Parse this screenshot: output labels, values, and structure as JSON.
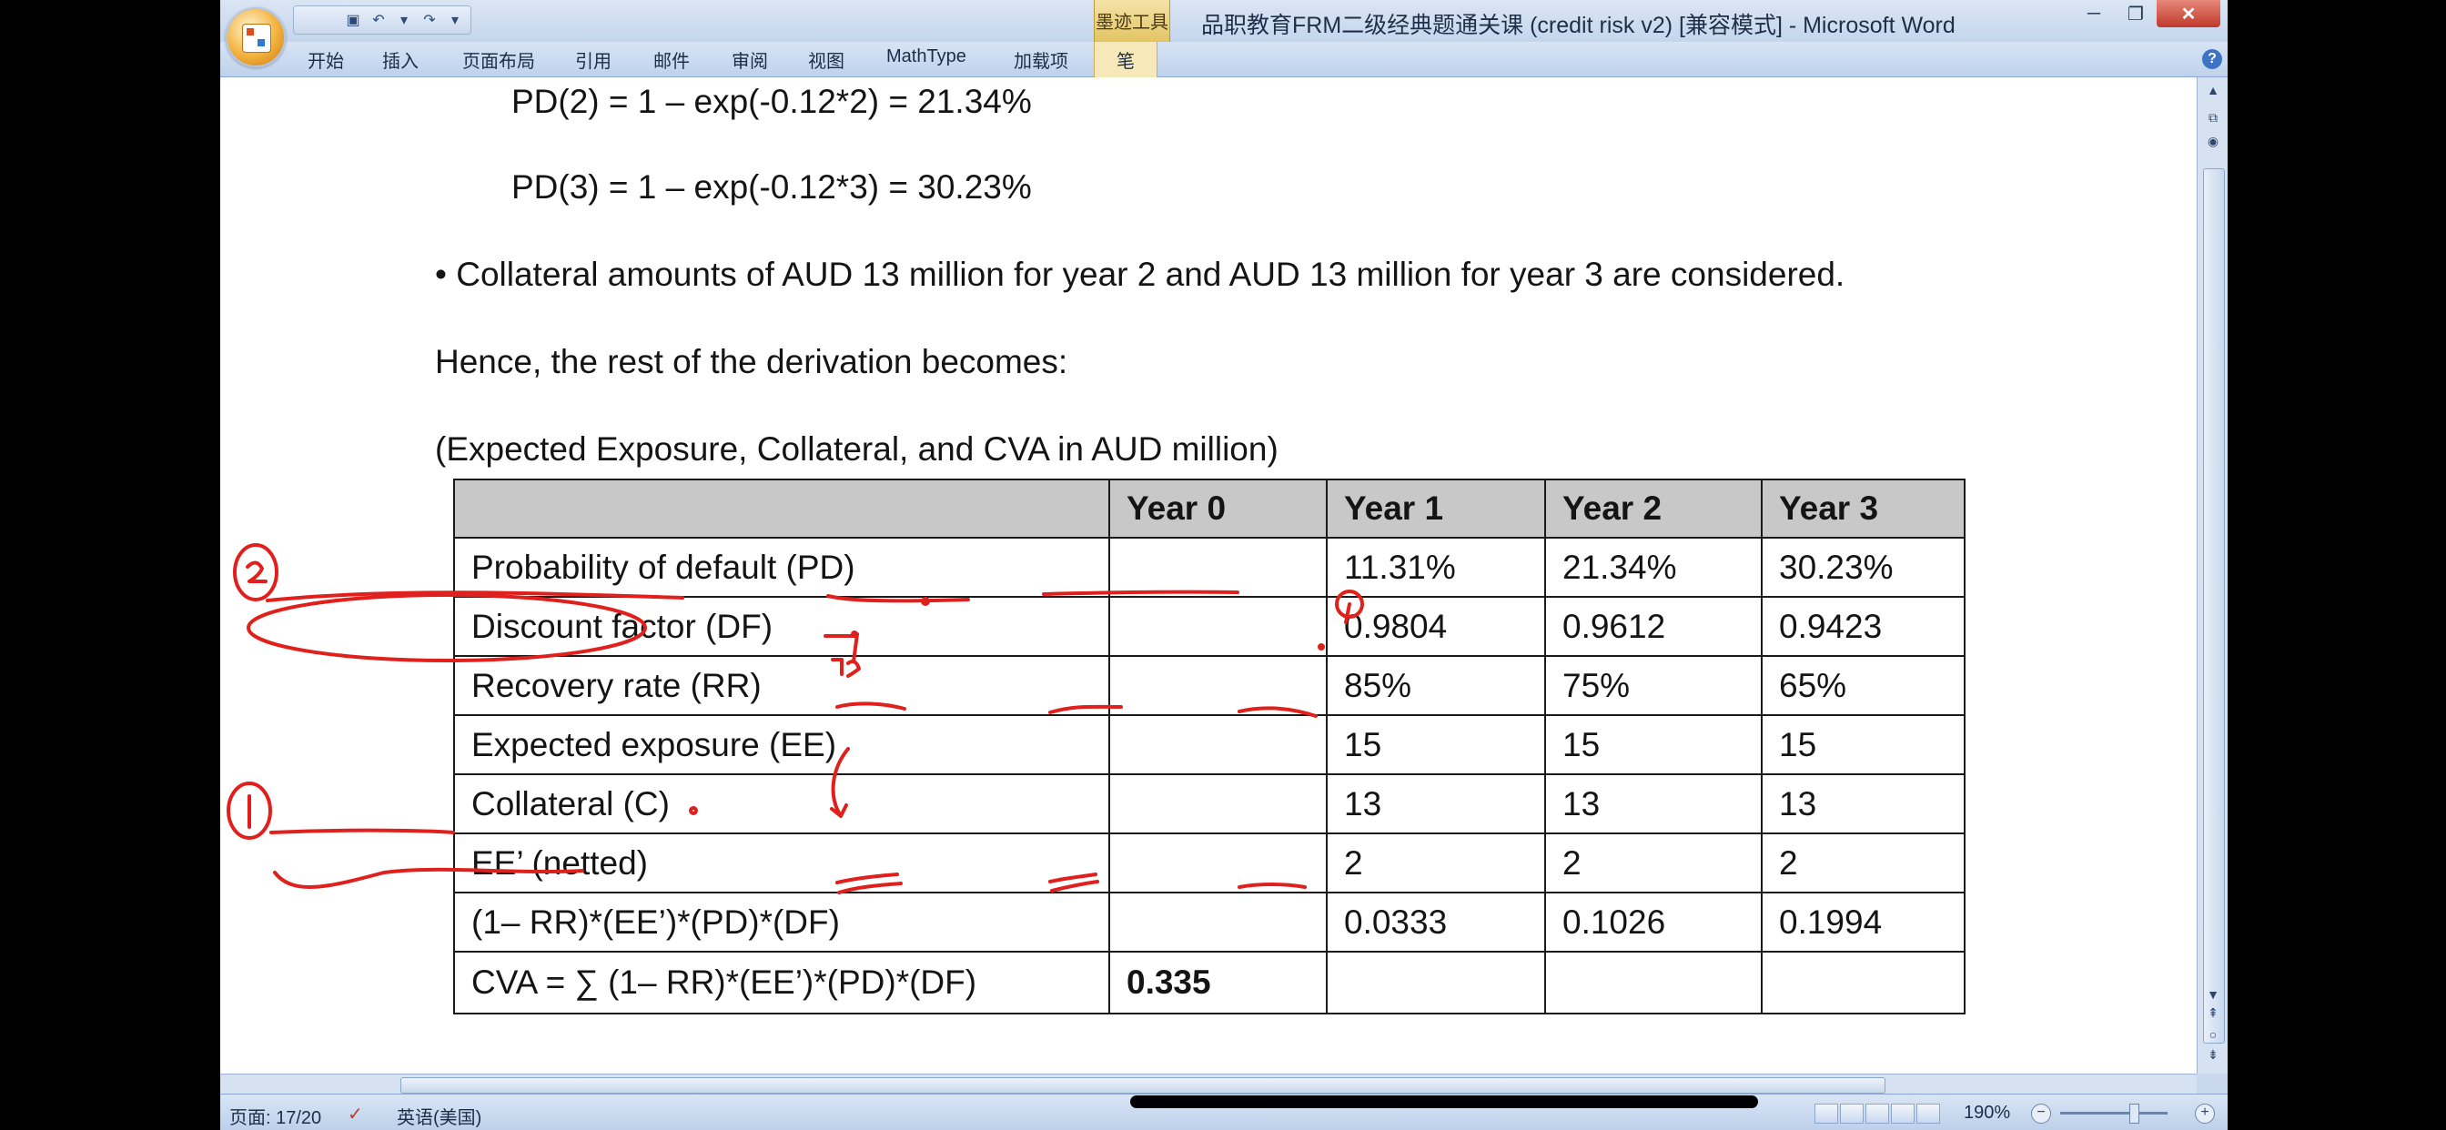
{
  "app": {
    "window_title": "品职教育FRM二级经典题通关课 (credit risk v2) [兼容模式] - Microsoft Word",
    "contextual_tab_label": "墨迹工具",
    "ribbon_tabs": [
      "开始",
      "插入",
      "页面布局",
      "引用",
      "邮件",
      "审阅",
      "视图",
      "MathType",
      "加载项",
      "笔"
    ]
  },
  "status": {
    "page": "页面: 17/20",
    "language": "英语(美国)",
    "zoom": "190%"
  },
  "document": {
    "pd2": "PD(2) = 1 – exp(-0.12*2) = 21.34%",
    "pd3": "PD(3) = 1 – exp(-0.12*3) = 30.23%",
    "bullet": "• Collateral amounts of AUD 13 million for year 2 and AUD 13 million for year 3 are considered.",
    "hence": "Hence, the rest of the derivation becomes:",
    "table_caption": "(Expected Exposure, Collateral, and CVA in AUD million)",
    "table": {
      "headers": [
        "",
        "Year 0",
        "Year 1",
        "Year 2",
        "Year 3"
      ],
      "rows": [
        [
          "Probability of default (PD)",
          "",
          "11.31%",
          "21.34%",
          "30.23%"
        ],
        [
          "Discount factor (DF)",
          "",
          "0.9804",
          "0.9612",
          "0.9423"
        ],
        [
          "Recovery rate (RR)",
          "",
          "85%",
          "75%",
          "65%"
        ],
        [
          "Expected exposure (EE)",
          "",
          "15",
          "15",
          "15"
        ],
        [
          "Collateral (C)",
          "",
          "13",
          "13",
          "13"
        ],
        [
          "EE’ (netted)",
          "",
          "2",
          "2",
          "2"
        ],
        [
          "(1– RR)*(EE’)*(PD)*(DF)",
          "",
          "0.0333",
          "0.1026",
          "0.1994"
        ],
        [
          "CVA = ∑ (1– RR)*(EE’)*(PD)*(DF)",
          "0.335",
          "",
          "",
          ""
        ]
      ]
    }
  },
  "colors": {
    "annotation_red": "#e0201c",
    "ribbon_blue": "#c4d5ec",
    "table_header_gray": "#c8c8c8"
  }
}
